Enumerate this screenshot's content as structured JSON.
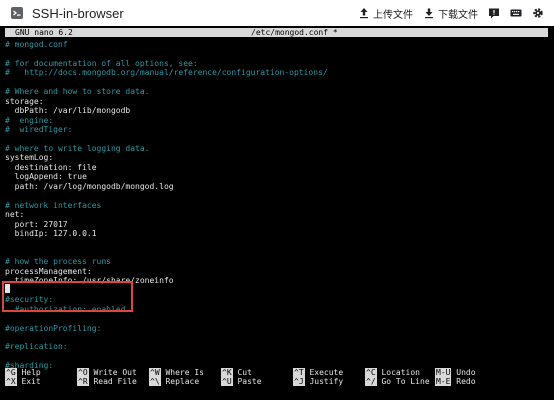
{
  "app": {
    "title": "SSH-in-browser",
    "upload_label": "上传文件",
    "download_label": "下载文件"
  },
  "nano": {
    "version": "GNU nano 6.2",
    "filename": "/etc/mongod.conf *"
  },
  "lines": [
    {
      "text": "# mongod.conf",
      "cls": "c"
    },
    {
      "text": "",
      "cls": "w"
    },
    {
      "text": "# for documentation of all options, see:",
      "cls": "c"
    },
    {
      "text": "#   http://docs.mongodb.org/manual/reference/configuration-options/",
      "cls": "c"
    },
    {
      "text": "",
      "cls": "w"
    },
    {
      "text": "# Where and how to store data.",
      "cls": "c"
    },
    {
      "text": "storage:",
      "cls": "w"
    },
    {
      "text": "  dbPath: /var/lib/mongodb",
      "cls": "w"
    },
    {
      "text": "#  engine:",
      "cls": "c"
    },
    {
      "text": "#  wiredTiger:",
      "cls": "c"
    },
    {
      "text": "",
      "cls": "w"
    },
    {
      "text": "# where to write logging data.",
      "cls": "c"
    },
    {
      "text": "systemLog:",
      "cls": "w"
    },
    {
      "text": "  destination: file",
      "cls": "w"
    },
    {
      "text": "  logAppend: true",
      "cls": "w"
    },
    {
      "text": "  path: /var/log/mongodb/mongod.log",
      "cls": "w"
    },
    {
      "text": "",
      "cls": "w"
    },
    {
      "text": "# network interfaces",
      "cls": "c"
    },
    {
      "text": "net:",
      "cls": "w"
    },
    {
      "text": "  port: 27017",
      "cls": "w"
    },
    {
      "text": "  bindIp: 127.0.0.1",
      "cls": "w"
    },
    {
      "text": "",
      "cls": "w"
    },
    {
      "text": "",
      "cls": "w"
    },
    {
      "text": "# how the process runs",
      "cls": "c"
    },
    {
      "text": "processManagement:",
      "cls": "w"
    },
    {
      "text": "  timeZoneInfo: /usr/share/zoneinfo",
      "cls": "w"
    },
    {
      "text": "",
      "cls": "w"
    },
    {
      "text": "#security:",
      "cls": "c"
    },
    {
      "text": "  #authorization: enabled",
      "cls": "c"
    },
    {
      "text": "",
      "cls": "w"
    },
    {
      "text": "#operationProfiling:",
      "cls": "c"
    },
    {
      "text": "",
      "cls": "w"
    },
    {
      "text": "#replication:",
      "cls": "c"
    },
    {
      "text": "",
      "cls": "w"
    },
    {
      "text": "#sharding:",
      "cls": "c"
    }
  ],
  "shortcuts_row1": [
    {
      "key": "^G",
      "label": "Help"
    },
    {
      "key": "^O",
      "label": "Write Out"
    },
    {
      "key": "^W",
      "label": "Where Is"
    },
    {
      "key": "^K",
      "label": "Cut"
    },
    {
      "key": "^T",
      "label": "Execute"
    },
    {
      "key": "^C",
      "label": "Location"
    },
    {
      "key": "M-U",
      "label": "Undo"
    }
  ],
  "shortcuts_row2": [
    {
      "key": "^X",
      "label": "Exit"
    },
    {
      "key": "^R",
      "label": "Read File"
    },
    {
      "key": "^\\",
      "label": "Replace"
    },
    {
      "key": "^U",
      "label": "Paste"
    },
    {
      "key": "^J",
      "label": "Justify"
    },
    {
      "key": "^/",
      "label": "Go To Line"
    },
    {
      "key": "M-E",
      "label": "Redo"
    }
  ],
  "colors": {
    "comment": "#2c9aa3",
    "text": "#e6e6e6",
    "highlight": "#e0443f"
  }
}
